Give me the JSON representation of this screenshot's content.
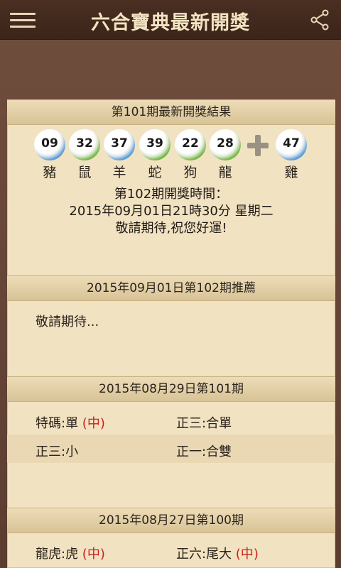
{
  "app": {
    "title": "六合寶典最新開獎"
  },
  "latest": {
    "header": "第101期最新開獎結果",
    "balls": [
      {
        "num": "09",
        "color": "blue",
        "zodiac": "豬"
      },
      {
        "num": "32",
        "color": "green",
        "zodiac": "鼠"
      },
      {
        "num": "37",
        "color": "blue",
        "zodiac": "羊"
      },
      {
        "num": "39",
        "color": "green",
        "zodiac": "蛇"
      },
      {
        "num": "22",
        "color": "green",
        "zodiac": "狗"
      },
      {
        "num": "28",
        "color": "green",
        "zodiac": "龍"
      }
    ],
    "special": {
      "num": "47",
      "color": "blue",
      "zodiac": "雞"
    },
    "next_line1": "第102期開獎時間：",
    "next_line2": "2015年09月01日21時30分 星期二",
    "next_line3": "敬請期待,祝您好運!"
  },
  "recommend": {
    "header": "2015年09月01日第102期推薦",
    "text": "敬請期待..."
  },
  "period101": {
    "header": "2015年08月29日第101期",
    "r1c1": "特碼:單 ",
    "r1c1_tag": "(中)",
    "r1c2": "正三:合單",
    "r2c1": "正三:小",
    "r2c2": "正一:合雙"
  },
  "period100": {
    "header": "2015年08月27日第100期",
    "r1c1": "龍虎:虎 ",
    "r1c1_tag": "(中)",
    "r1c2": "正六:尾大 ",
    "r1c2_tag": "(中)"
  },
  "colors": {
    "accent_red": "#c8231d",
    "ball_blue": "#2f73b7",
    "ball_green": "#3f8a24"
  }
}
